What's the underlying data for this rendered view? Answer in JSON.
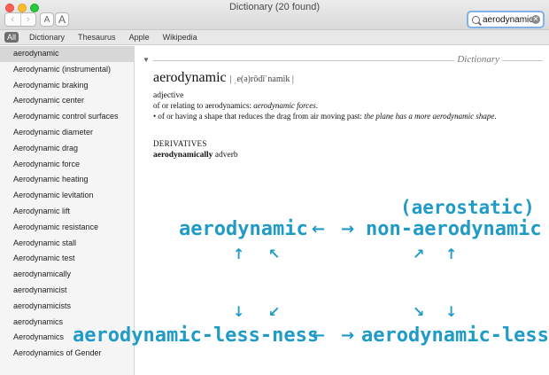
{
  "window": {
    "title": "Dictionary (20 found)"
  },
  "toolbar": {
    "back_icon": "‹",
    "forward_icon": "›",
    "font_smaller_label": "A",
    "font_larger_label": "A",
    "search_value": "aerodynamic",
    "clear_icon": "✕"
  },
  "scope_tabs": [
    "All",
    "Dictionary",
    "Thesaurus",
    "Apple",
    "Wikipedia"
  ],
  "sidebar": {
    "items": [
      "aerodynamic",
      "Aerodynamic (instrumental)",
      "Aerodynamic braking",
      "Aerodynamic center",
      "Aerodynamic control surfaces",
      "Aerodynamic diameter",
      "Aerodynamic drag",
      "Aerodynamic force",
      "Aerodynamic heating",
      "Aerodynamic levitation",
      "Aerodynamic lift",
      "Aerodynamic resistance",
      "Aerodynamic stall",
      "Aerodynamic test",
      "aerodynamically",
      "aerodynamicist",
      "aerodynamicists",
      "aerodynamics",
      "Aerodynamics",
      "Aerodynamics of Gender"
    ]
  },
  "entry": {
    "section_label": "Dictionary",
    "headword": "aerodynamic",
    "pronunciation": "| ˌe(ə)rōdīˈnamik |",
    "part_of_speech": "adjective",
    "sense1_text": "of or relating to aerodynamics: ",
    "sense1_example": "aerodynamic forces",
    "sense1_end": ".",
    "sense2_text": "• of or having a shape that reduces the drag from air moving past: ",
    "sense2_example": "the plane has a more aerodynamic shape",
    "sense2_end": ".",
    "derivatives_heading": "DERIVATIVES",
    "derivative_word": "aerodynamically",
    "derivative_pos": "adverb"
  },
  "overlay": {
    "aerostatic": "(aerostatic)",
    "aerodynamic": "aerodynamic",
    "non_aerodynamic": "non-aerodynamic",
    "aerodynamic_less_ness": "aerodynamic-less-ness",
    "aerodynamic_less": "aerodynamic-less",
    "arrow_left": "←",
    "arrow_right": "→",
    "arrow_up": "↑",
    "arrow_down": "↓",
    "arrow_up_left": "↖",
    "arrow_up_right": "↗",
    "arrow_down_left": "↙",
    "arrow_down_right": "↘",
    "color": "#1f9bc6"
  }
}
